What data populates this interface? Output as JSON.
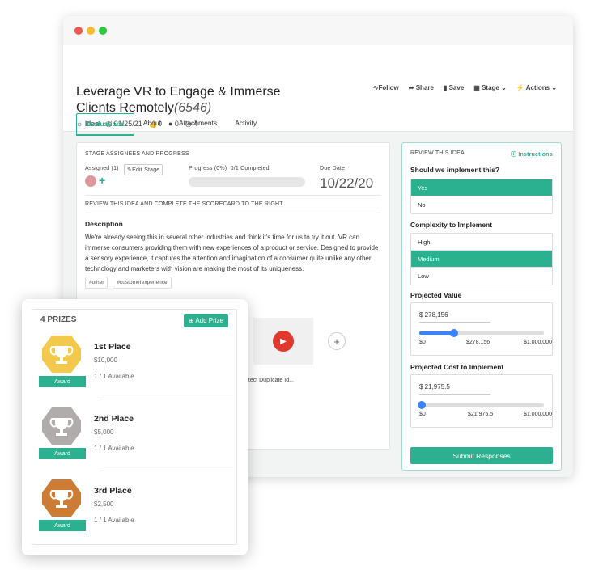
{
  "idea": {
    "title": "Leverage VR to Engage & Immerse Clients Remotely",
    "id": "(6546)",
    "type": "Idea",
    "date": "01/25/21",
    "likes": "0",
    "comments": "0",
    "views": "4"
  },
  "actions": [
    "Follow",
    "Share",
    "Save",
    "Stage",
    "Actions"
  ],
  "tabs": [
    "Evaluations",
    "About",
    "Attachments",
    "Activity"
  ],
  "stage": {
    "header": "STAGE ASSIGNEES AND PROGRESS",
    "assigned_label": "Assigned (1)",
    "edit_label": "Edit Stage",
    "progress_label": "Progress (0%)",
    "progress_completed": "0/1 Completed",
    "progress_value": 0,
    "due_label": "Due Date",
    "due_date": "10/22/20"
  },
  "review_prompt": "REVIEW THIS IDEA AND COMPLETE THE SCORECARD TO THE RIGHT",
  "description": {
    "heading": "Description",
    "text": "We're already seeing this in several other industries and think it's time for us to try it out. VR can immerse consumers providing them with new experiences of a product or service. Designed to provide a sensory experience, it captures the attention and imagination of a consumer quite unlike any other technology and marketers with vision are making the most of its uniqueness."
  },
  "tags": [
    "#other",
    "#customerexperience"
  ],
  "attachment": {
    "file_label": "etect Duplicate Id..."
  },
  "review": {
    "header": "REVIEW THIS IDEA",
    "instructions": "Instructions",
    "q1": "Should we implement this?",
    "q1_options": [
      "Yes",
      "No"
    ],
    "q1_selected": "Yes",
    "q2": "Complexity to Implement",
    "q2_options": [
      "High",
      "Medium",
      "Low"
    ],
    "q2_selected": "Medium",
    "q3": "Projected Value",
    "q3_value": "$ 278,156",
    "q3_fraction": 0.278,
    "q3_ticks": [
      "$0",
      "$278,156",
      "$1,000,000"
    ],
    "q4": "Projected Cost to Implement",
    "q4_value": "$ 21,975.5",
    "q4_fraction": 0.022,
    "q4_ticks": [
      "$0",
      "$21,975.5",
      "$1,000,000"
    ],
    "submit": "Submit Responses"
  },
  "prizes": {
    "header": "4 PRIZES",
    "add_label": "Add Prize",
    "award_label": "Award",
    "items": [
      {
        "name": "1st Place",
        "amount": "$10,000",
        "available": "1 / 1 Available",
        "color": "#f2c94c"
      },
      {
        "name": "2nd Place",
        "amount": "$5,000",
        "available": "1 / 1 Available",
        "color": "#b0acac"
      },
      {
        "name": "3rd Place",
        "amount": "$2,500",
        "available": "1 / 1 Available",
        "color": "#cd7c35"
      }
    ]
  },
  "colors": {
    "accent": "#2bb18f",
    "slider": "#3b82f6",
    "play": "#e03a2e"
  }
}
